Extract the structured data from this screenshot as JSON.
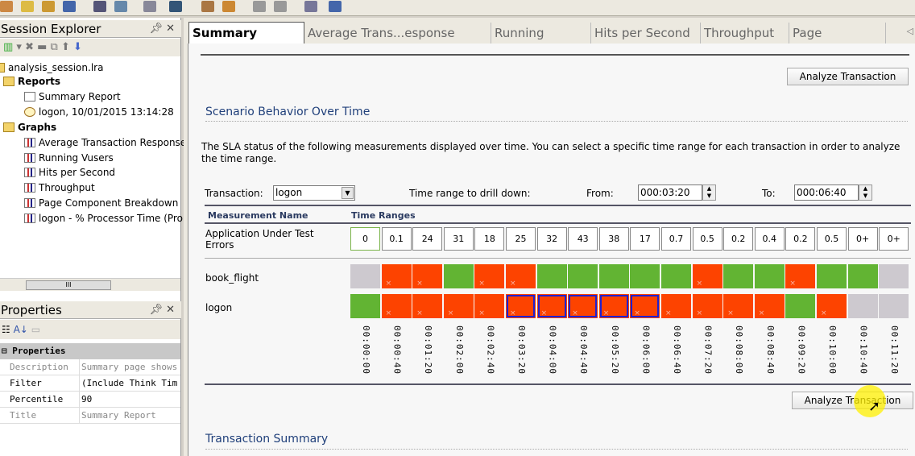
{
  "toolbar": {
    "icons": [
      "new-session-icon",
      "open-icon",
      "add-graph-icon",
      "save-icon",
      "print-icon",
      "report-icon",
      "copy-icon",
      "filter-icon",
      "template-icon",
      "refresh-icon",
      "undo-icon",
      "redo-icon",
      "paste-icon",
      "window-icon"
    ]
  },
  "session_explorer": {
    "title": "Session Explorer",
    "tree": [
      {
        "label": "analysis_session.lra",
        "icon": "session-icon",
        "level": 0,
        "bold": false
      },
      {
        "label": "Reports",
        "icon": "folder-icon",
        "level": 1,
        "bold": true
      },
      {
        "label": "Summary Report",
        "icon": "document-icon",
        "level": 2,
        "bold": false
      },
      {
        "label": "logon, 10/01/2015 13:14:28",
        "icon": "clock-icon",
        "level": 2,
        "bold": false
      },
      {
        "label": "Graphs",
        "icon": "folder-icon",
        "level": 1,
        "bold": true
      },
      {
        "label": "Average Transaction Response",
        "icon": "chart-icon",
        "level": 2,
        "bold": false
      },
      {
        "label": "Running Vusers",
        "icon": "chart-icon",
        "level": 2,
        "bold": false
      },
      {
        "label": "Hits per Second",
        "icon": "chart-icon",
        "level": 2,
        "bold": false
      },
      {
        "label": "Throughput",
        "icon": "chart-icon",
        "level": 2,
        "bold": false
      },
      {
        "label": "Page Component Breakdown",
        "icon": "chart-icon",
        "level": 2,
        "bold": false
      },
      {
        "label": "logon - % Processor Time (Pro",
        "icon": "chart-icon",
        "level": 2,
        "bold": false
      }
    ]
  },
  "properties": {
    "title": "Properties",
    "group": "Properties",
    "rows": [
      {
        "name": "Description",
        "value": "Summary page shows",
        "dim": true
      },
      {
        "name": "Filter",
        "value": "(Include Think Tim",
        "dim": false
      },
      {
        "name": "Percentile",
        "value": "90",
        "dim": false
      },
      {
        "name": "Title",
        "value": "Summary Report",
        "dim": true
      }
    ]
  },
  "tabs": [
    "Summary Report",
    "Average Trans...esponse Time",
    "Running Vusers",
    "Hits per Second",
    "Throughput",
    "Page Component"
  ],
  "content": {
    "analyze_button": "Analyze Transaction",
    "section_title": "Scenario Behavior Over Time",
    "description": "The SLA status of the following measurements displayed over time. You can select a specific time range for each transaction in order to analyze the time range.",
    "transaction_label": "Transaction:",
    "transaction_value": "logon",
    "drill_label": "Time range to drill down:",
    "from_label": "From:",
    "from_value": "000:03:20",
    "to_label": "To:",
    "to_value": "000:06:40",
    "col_measurement": "Measurement Name",
    "col_time_ranges": "Time Ranges",
    "errors_label": "Application Under Test Errors",
    "errors_values": [
      "0",
      "0.1",
      "24",
      "31",
      "18",
      "25",
      "32",
      "43",
      "38",
      "17",
      "0.7",
      "0.5",
      "0.2",
      "0.4",
      "0.2",
      "0.5",
      "0+",
      "0+"
    ],
    "transactions": [
      {
        "name": "book_flight",
        "status": [
          "na",
          "bad",
          "bad",
          "ok",
          "bad",
          "bad",
          "ok",
          "ok",
          "ok",
          "ok",
          "ok",
          "bad",
          "ok",
          "ok",
          "bad",
          "ok",
          "ok",
          "na"
        ]
      },
      {
        "name": "logon",
        "status": [
          "ok",
          "bad",
          "bad",
          "bad",
          "bad",
          "bad",
          "bad",
          "bad",
          "bad",
          "bad",
          "bad",
          "bad",
          "bad",
          "bad",
          "ok",
          "bad",
          "na",
          "na"
        ],
        "selected_range": [
          5,
          9
        ]
      }
    ],
    "time_labels": [
      "00:00:00",
      "00:00:40",
      "00:01:20",
      "00:02:00",
      "00:02:40",
      "00:03:20",
      "00:04:00",
      "00:04:40",
      "00:05:20",
      "00:06:00",
      "00:06:40",
      "00:07:20",
      "00:08:00",
      "00:08:40",
      "00:09:20",
      "00:10:00",
      "00:10:40",
      "00:11:20"
    ],
    "analyze_button_2": "Analyze Transaction",
    "section_title_2": "Transaction Summary",
    "colors": {
      "pass": "#62b433",
      "fail": "#fd4300",
      "no_data": "#cdc9cf",
      "selection": "#2020d0"
    }
  }
}
